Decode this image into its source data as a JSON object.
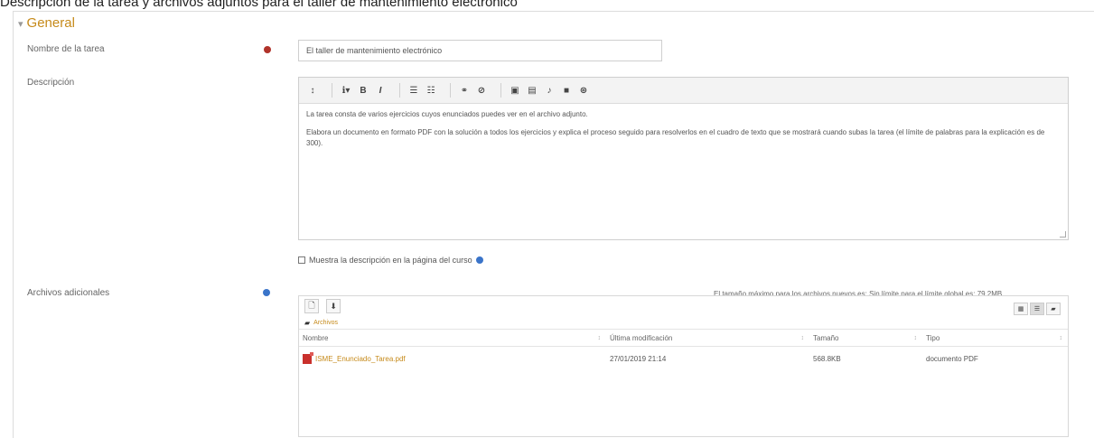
{
  "caption": "Descripción de la tarea y archivos adjuntos para el taller de mantenimiento electrónico",
  "section": {
    "title": "General"
  },
  "fields": {
    "name_label": "Nombre de la tarea",
    "name_value": "El taller de mantenimiento electrónico",
    "description_label": "Descripción",
    "files_label": "Archivos adicionales"
  },
  "editor": {
    "paragraph1": "La tarea consta de varios ejercicios cuyos enunciados puedes ver en el archivo adjunto.",
    "paragraph2": "Elabora un documento en formato PDF con la solución a todos los ejercicios y explica el proceso seguido para resolverlos en el cuadro de texto que se mostrará cuando subas la tarea (el límite de palabras para la explicación es de 300)."
  },
  "checkbox": {
    "label": "Muestra la descripción en la página del curso"
  },
  "filemanager": {
    "size_note": "El tamaño máximo para los archivos nuevos es: Sin límite,para el límite global es: 79.2MB",
    "breadcrumb": "Archivos",
    "columns": [
      "Nombre",
      "Última modificación",
      "Tamaño",
      "Tipo"
    ],
    "files": [
      {
        "name": "ISME_Enunciado_Tarea.pdf",
        "modified": "27/01/2019 21:14",
        "size": "568.8KB",
        "type": "documento PDF"
      }
    ]
  },
  "colors": {
    "accent": "#c68a1a",
    "required": "#b0332a",
    "help": "#3a74c9",
    "pdf": "#c9302c"
  }
}
